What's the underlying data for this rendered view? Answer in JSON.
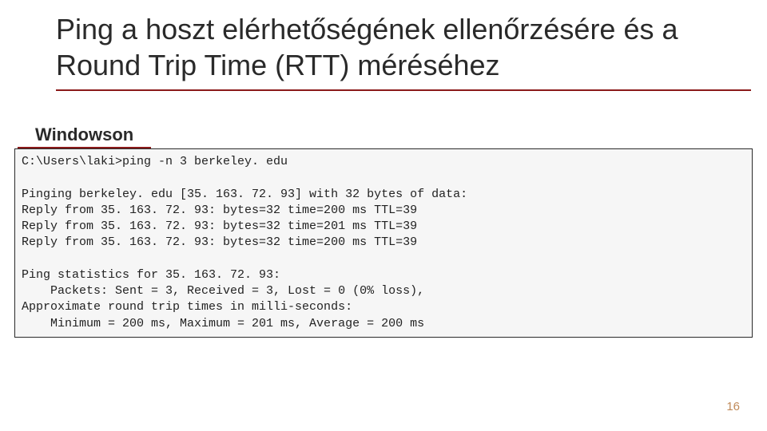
{
  "title": "Ping a hoszt elérhetőségének ellenőrzésére és a Round Trip Time (RTT) méréséhez",
  "section_label": "Windowson",
  "terminal": {
    "line1": "C:\\Users\\laki>ping -n 3 berkeley. edu",
    "blank1": "",
    "line2": "Pinging berkeley. edu [35. 163. 72. 93] with 32 bytes of data:",
    "line3": "Reply from 35. 163. 72. 93: bytes=32 time=200 ms TTL=39",
    "line4": "Reply from 35. 163. 72. 93: bytes=32 time=201 ms TTL=39",
    "line5": "Reply from 35. 163. 72. 93: bytes=32 time=200 ms TTL=39",
    "blank2": "",
    "line6": "Ping statistics for 35. 163. 72. 93:",
    "line7": "    Packets: Sent = 3, Received = 3, Lost = 0 (0% loss),",
    "line8": "Approximate round trip times in milli-seconds:",
    "line9": "    Minimum = 200 ms, Maximum = 201 ms, Average = 200 ms"
  },
  "page_number": "16"
}
